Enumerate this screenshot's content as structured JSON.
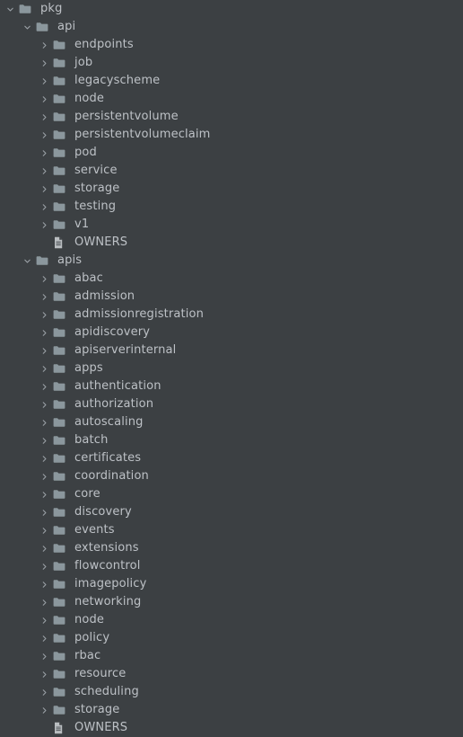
{
  "panel": {
    "name": "project-file-tree",
    "background_color": "#3c4043",
    "text_color": "#bdc1c6",
    "folder_icon_color": "#8b979d",
    "file_icon_color": "#b9bdc0",
    "chevron_color": "#9aa0a6"
  },
  "icons": {
    "folder": "folder-icon",
    "file": "file-icon",
    "chevron_expanded": "chevron-down-icon",
    "chevron_collapsed": "chevron-right-icon"
  },
  "tree": [
    {
      "label": "pkg",
      "depth": 0,
      "type": "folder",
      "state": "expanded"
    },
    {
      "label": "api",
      "depth": 1,
      "type": "folder",
      "state": "expanded"
    },
    {
      "label": "endpoints",
      "depth": 2,
      "type": "folder",
      "state": "collapsed"
    },
    {
      "label": "job",
      "depth": 2,
      "type": "folder",
      "state": "collapsed"
    },
    {
      "label": "legacyscheme",
      "depth": 2,
      "type": "folder",
      "state": "collapsed"
    },
    {
      "label": "node",
      "depth": 2,
      "type": "folder",
      "state": "collapsed"
    },
    {
      "label": "persistentvolume",
      "depth": 2,
      "type": "folder",
      "state": "collapsed"
    },
    {
      "label": "persistentvolumeclaim",
      "depth": 2,
      "type": "folder",
      "state": "collapsed"
    },
    {
      "label": "pod",
      "depth": 2,
      "type": "folder",
      "state": "collapsed"
    },
    {
      "label": "service",
      "depth": 2,
      "type": "folder",
      "state": "collapsed"
    },
    {
      "label": "storage",
      "depth": 2,
      "type": "folder",
      "state": "collapsed"
    },
    {
      "label": "testing",
      "depth": 2,
      "type": "folder",
      "state": "collapsed"
    },
    {
      "label": "v1",
      "depth": 2,
      "type": "folder",
      "state": "collapsed"
    },
    {
      "label": "OWNERS",
      "depth": 2,
      "type": "file",
      "state": "leaf"
    },
    {
      "label": "apis",
      "depth": 1,
      "type": "folder",
      "state": "expanded"
    },
    {
      "label": "abac",
      "depth": 2,
      "type": "folder",
      "state": "collapsed"
    },
    {
      "label": "admission",
      "depth": 2,
      "type": "folder",
      "state": "collapsed"
    },
    {
      "label": "admissionregistration",
      "depth": 2,
      "type": "folder",
      "state": "collapsed"
    },
    {
      "label": "apidiscovery",
      "depth": 2,
      "type": "folder",
      "state": "collapsed"
    },
    {
      "label": "apiserverinternal",
      "depth": 2,
      "type": "folder",
      "state": "collapsed"
    },
    {
      "label": "apps",
      "depth": 2,
      "type": "folder",
      "state": "collapsed"
    },
    {
      "label": "authentication",
      "depth": 2,
      "type": "folder",
      "state": "collapsed"
    },
    {
      "label": "authorization",
      "depth": 2,
      "type": "folder",
      "state": "collapsed"
    },
    {
      "label": "autoscaling",
      "depth": 2,
      "type": "folder",
      "state": "collapsed"
    },
    {
      "label": "batch",
      "depth": 2,
      "type": "folder",
      "state": "collapsed"
    },
    {
      "label": "certificates",
      "depth": 2,
      "type": "folder",
      "state": "collapsed"
    },
    {
      "label": "coordination",
      "depth": 2,
      "type": "folder",
      "state": "collapsed"
    },
    {
      "label": "core",
      "depth": 2,
      "type": "folder",
      "state": "collapsed"
    },
    {
      "label": "discovery",
      "depth": 2,
      "type": "folder",
      "state": "collapsed"
    },
    {
      "label": "events",
      "depth": 2,
      "type": "folder",
      "state": "collapsed"
    },
    {
      "label": "extensions",
      "depth": 2,
      "type": "folder",
      "state": "collapsed"
    },
    {
      "label": "flowcontrol",
      "depth": 2,
      "type": "folder",
      "state": "collapsed"
    },
    {
      "label": "imagepolicy",
      "depth": 2,
      "type": "folder",
      "state": "collapsed"
    },
    {
      "label": "networking",
      "depth": 2,
      "type": "folder",
      "state": "collapsed"
    },
    {
      "label": "node",
      "depth": 2,
      "type": "folder",
      "state": "collapsed"
    },
    {
      "label": "policy",
      "depth": 2,
      "type": "folder",
      "state": "collapsed"
    },
    {
      "label": "rbac",
      "depth": 2,
      "type": "folder",
      "state": "collapsed"
    },
    {
      "label": "resource",
      "depth": 2,
      "type": "folder",
      "state": "collapsed"
    },
    {
      "label": "scheduling",
      "depth": 2,
      "type": "folder",
      "state": "collapsed"
    },
    {
      "label": "storage",
      "depth": 2,
      "type": "folder",
      "state": "collapsed"
    },
    {
      "label": "OWNERS",
      "depth": 2,
      "type": "file",
      "state": "leaf"
    }
  ]
}
